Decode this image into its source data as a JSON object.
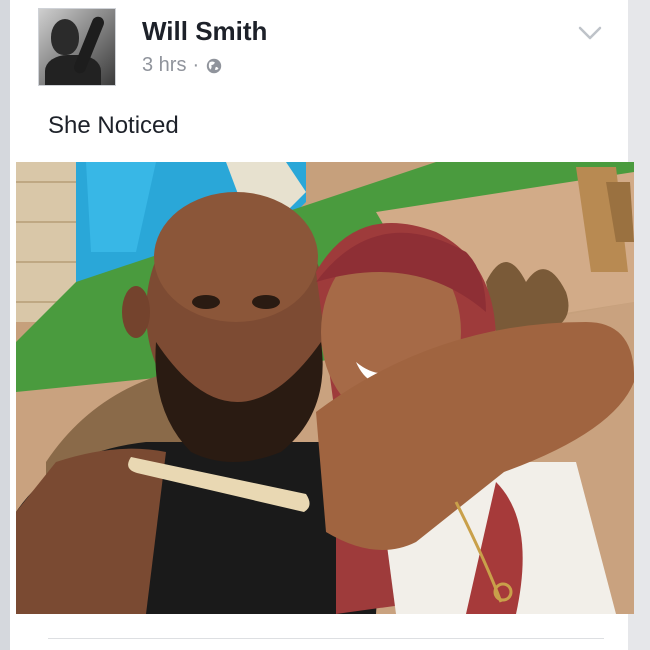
{
  "post": {
    "author": "Will Smith",
    "time": "3 hrs",
    "separator": "·",
    "privacy_icon": "globe-icon",
    "menu_icon": "chevron-down-icon",
    "text": "She Noticed"
  },
  "colors": {
    "name": "#1d2129",
    "meta": "#90949c",
    "background": "#e9ebee"
  }
}
